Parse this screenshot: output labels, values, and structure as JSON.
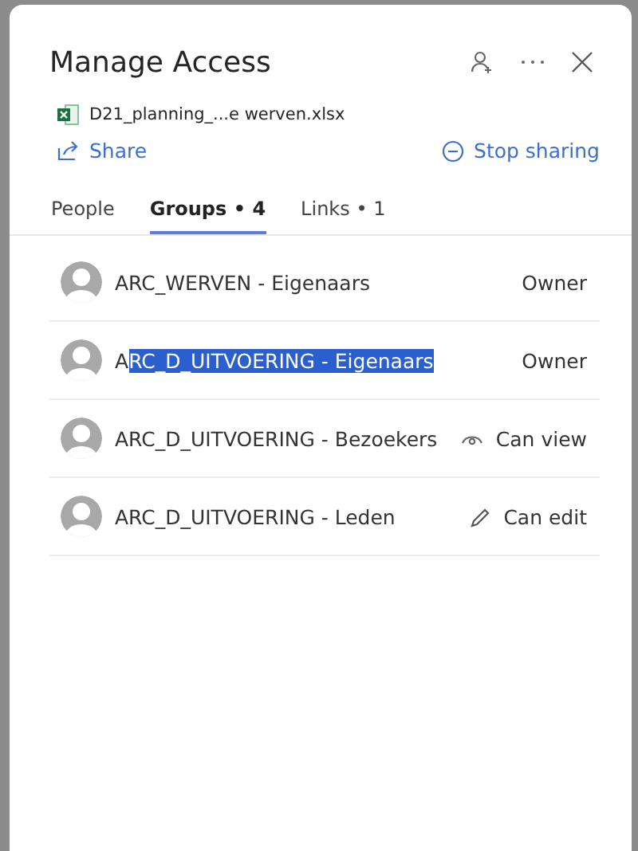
{
  "panel": {
    "title": "Manage Access",
    "file": "D21_planning_...e werven.xlsx",
    "share": "Share",
    "stop_sharing": "Stop sharing"
  },
  "tabs": [
    {
      "label": "People",
      "selected": false
    },
    {
      "label": "Groups • 4",
      "selected": true
    },
    {
      "label": "Links • 1",
      "selected": false
    }
  ],
  "groups": [
    {
      "name_parts": [
        {
          "text": "ARC_WERVEN - Eigenaars",
          "selected": false
        }
      ],
      "role": "Owner",
      "kind": "plain"
    },
    {
      "name_parts": [
        {
          "text": "A",
          "selected": false
        },
        {
          "text": "RC_D_UITVOERING - Eigenaars",
          "selected": true
        }
      ],
      "role": "Owner",
      "kind": "plain"
    },
    {
      "name_parts": [
        {
          "text": "ARC_D_UITVOERING - Bezoekers",
          "selected": false
        }
      ],
      "role": "Can view",
      "kind": "view"
    },
    {
      "name_parts": [
        {
          "text": "ARC_D_UITVOERING - Leden",
          "selected": false
        }
      ],
      "role": "Can edit",
      "kind": "edit"
    }
  ]
}
